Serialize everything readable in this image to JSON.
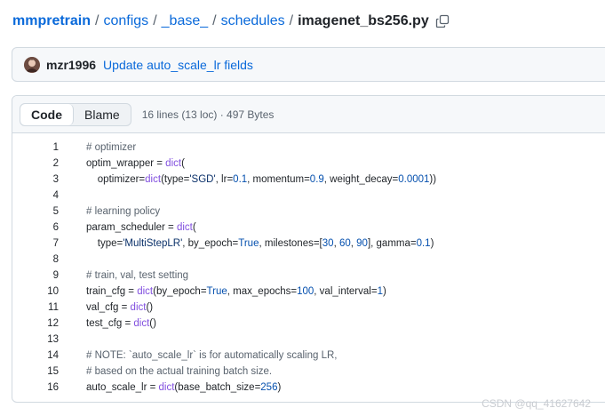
{
  "breadcrumb": {
    "repo": "mmpretrain",
    "dirs": [
      "configs",
      "_base_",
      "schedules"
    ],
    "file": "imagenet_bs256.py",
    "sep": "/"
  },
  "commit": {
    "author": "mzr1996",
    "message": "Update auto_scale_lr fields"
  },
  "file_header": {
    "tabs": [
      "Code",
      "Blame"
    ],
    "info": "16 lines (13 loc) · 497 Bytes"
  },
  "code_lines": [
    [
      {
        "t": "# optimizer",
        "k": "c"
      }
    ],
    [
      {
        "t": "optim_wrapper = "
      },
      {
        "t": "dict",
        "k": "f"
      },
      {
        "t": "("
      }
    ],
    [
      {
        "t": "    optimizer="
      },
      {
        "t": "dict",
        "k": "f"
      },
      {
        "t": "(type="
      },
      {
        "t": "'SGD'",
        "k": "s"
      },
      {
        "t": ", lr="
      },
      {
        "t": "0.1",
        "k": "n"
      },
      {
        "t": ", momentum="
      },
      {
        "t": "0.9",
        "k": "n"
      },
      {
        "t": ", weight_decay="
      },
      {
        "t": "0.0001",
        "k": "n"
      },
      {
        "t": "))"
      }
    ],
    [],
    [
      {
        "t": "# learning policy",
        "k": "c"
      }
    ],
    [
      {
        "t": "param_scheduler = "
      },
      {
        "t": "dict",
        "k": "f"
      },
      {
        "t": "("
      }
    ],
    [
      {
        "t": "    type="
      },
      {
        "t": "'MultiStepLR'",
        "k": "s"
      },
      {
        "t": ", by_epoch="
      },
      {
        "t": "True",
        "k": "n"
      },
      {
        "t": ", milestones=["
      },
      {
        "t": "30",
        "k": "n"
      },
      {
        "t": ", "
      },
      {
        "t": "60",
        "k": "n"
      },
      {
        "t": ", "
      },
      {
        "t": "90",
        "k": "n"
      },
      {
        "t": "], gamma="
      },
      {
        "t": "0.1",
        "k": "n"
      },
      {
        "t": ")"
      }
    ],
    [],
    [
      {
        "t": "# train, val, test setting",
        "k": "c"
      }
    ],
    [
      {
        "t": "train_cfg = "
      },
      {
        "t": "dict",
        "k": "f"
      },
      {
        "t": "(by_epoch="
      },
      {
        "t": "True",
        "k": "n"
      },
      {
        "t": ", max_epochs="
      },
      {
        "t": "100",
        "k": "n"
      },
      {
        "t": ", val_interval="
      },
      {
        "t": "1",
        "k": "n"
      },
      {
        "t": ")"
      }
    ],
    [
      {
        "t": "val_cfg = "
      },
      {
        "t": "dict",
        "k": "f"
      },
      {
        "t": "()"
      }
    ],
    [
      {
        "t": "test_cfg = "
      },
      {
        "t": "dict",
        "k": "f"
      },
      {
        "t": "()"
      }
    ],
    [],
    [
      {
        "t": "# NOTE: `auto_scale_lr` is for automatically scaling LR,",
        "k": "c"
      }
    ],
    [
      {
        "t": "# based on the actual training batch size.",
        "k": "c"
      }
    ],
    [
      {
        "t": "auto_scale_lr = "
      },
      {
        "t": "dict",
        "k": "f"
      },
      {
        "t": "(base_batch_size="
      },
      {
        "t": "256",
        "k": "n"
      },
      {
        "t": ")"
      }
    ]
  ],
  "watermark": "CSDN @qq_41627642",
  "colors": {
    "link": "#0969da",
    "comment": "#59636e",
    "function": "#8250df",
    "string": "#0a3069",
    "number": "#0550ae"
  },
  "icons": [
    "copy-icon",
    "avatar"
  ]
}
